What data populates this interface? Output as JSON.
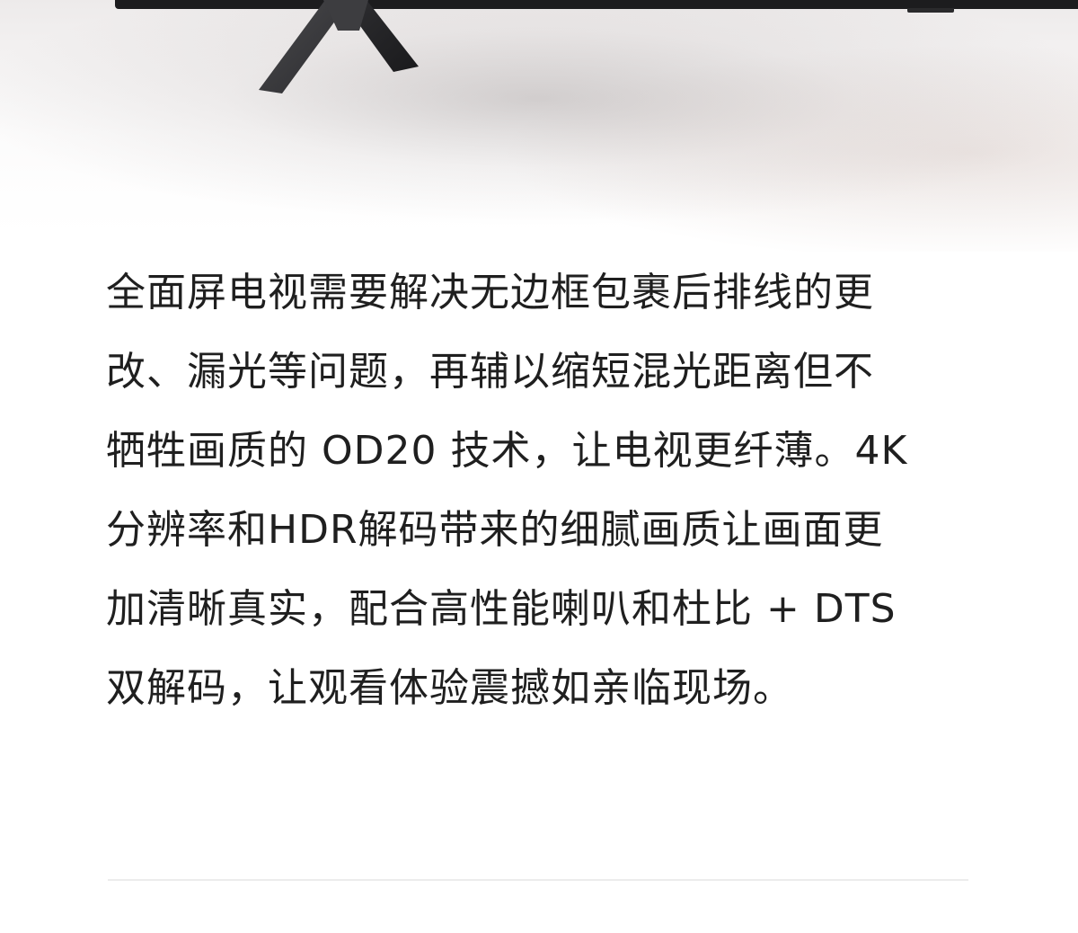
{
  "product_copy": {
    "lines": [
      "全面屏电视需要解决无边框包裹后排线的更",
      "改、漏光等问题，再辅以缩短混光距离但不",
      "牺牲画质的 OD20 技术，让电视更纤薄。4K",
      "分辨率和HDR解码带来的细腻画质让画面更",
      "加清晰真实，配合高性能喇叭和杜比 + DTS",
      "双解码，让观看体验震撼如亲临现场。"
    ]
  },
  "colors": {
    "text": "#1f1f1f",
    "tv_body": "#1c1c1e",
    "stand": "#3a3a3c",
    "divider": "#ececec"
  }
}
